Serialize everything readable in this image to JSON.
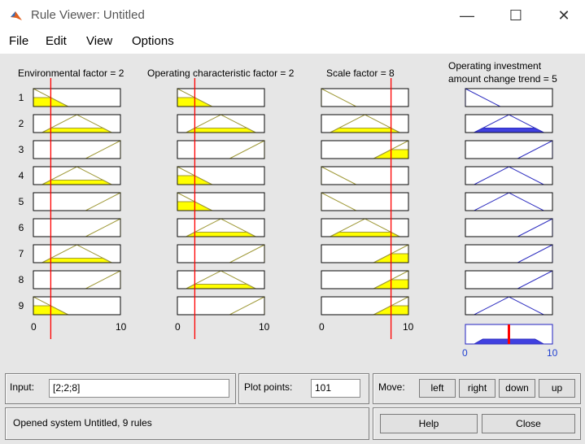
{
  "window": {
    "title": "Rule Viewer: Untitled",
    "minimize": "—",
    "maximize": "☐",
    "close": "✕"
  },
  "menu": [
    "File",
    "Edit",
    "View",
    "Options"
  ],
  "inputs": [
    {
      "title": "Environmental factor = 2",
      "value": 2,
      "range": [
        0,
        10
      ],
      "tick_min": "0",
      "tick_max": "10"
    },
    {
      "title": "Operating characteristic factor = 2",
      "value": 2,
      "range": [
        0,
        10
      ],
      "tick_min": "0",
      "tick_max": "10"
    },
    {
      "title": "Scale factor = 8",
      "value": 8,
      "range": [
        0,
        10
      ],
      "tick_min": "0",
      "tick_max": "10"
    }
  ],
  "output": {
    "title_line1": "Operating investment",
    "title_line2": "amount change trend = 5",
    "value": 5,
    "range": [
      0,
      10
    ],
    "tick_min": "0",
    "tick_max": "10"
  },
  "rules": [
    {
      "num": "1",
      "mf": [
        "low",
        "low",
        "low"
      ],
      "out": "low"
    },
    {
      "num": "2",
      "mf": [
        "mid",
        "mid",
        "mid"
      ],
      "out": "mid"
    },
    {
      "num": "3",
      "mf": [
        "high",
        "high",
        "high"
      ],
      "out": "high"
    },
    {
      "num": "4",
      "mf": [
        "mid",
        "low",
        "low"
      ],
      "out": "mid"
    },
    {
      "num": "5",
      "mf": [
        "high",
        "low",
        "low"
      ],
      "out": "mid"
    },
    {
      "num": "6",
      "mf": [
        "high",
        "mid",
        "mid"
      ],
      "out": "high"
    },
    {
      "num": "7",
      "mf": [
        "mid",
        "high",
        "high"
      ],
      "out": "high"
    },
    {
      "num": "8",
      "mf": [
        "high",
        "mid",
        "high"
      ],
      "out": "high"
    },
    {
      "num": "9",
      "mf": [
        "low",
        "high",
        "high"
      ],
      "out": "mid"
    }
  ],
  "colors": {
    "input_mf": "#a09a3a",
    "fill": "#ffff00",
    "output_mf": "#3030c0",
    "output_fill": "#4040e0",
    "marker": "#ff0000"
  },
  "bottom": {
    "input_label": "Input:",
    "input_value": "[2;2;8]",
    "plot_points_label": "Plot points:",
    "plot_points_value": "101",
    "move_label": "Move:",
    "move_buttons": [
      "left",
      "right",
      "down",
      "up"
    ],
    "status": "Opened system Untitled, 9 rules",
    "help": "Help",
    "close": "Close"
  }
}
